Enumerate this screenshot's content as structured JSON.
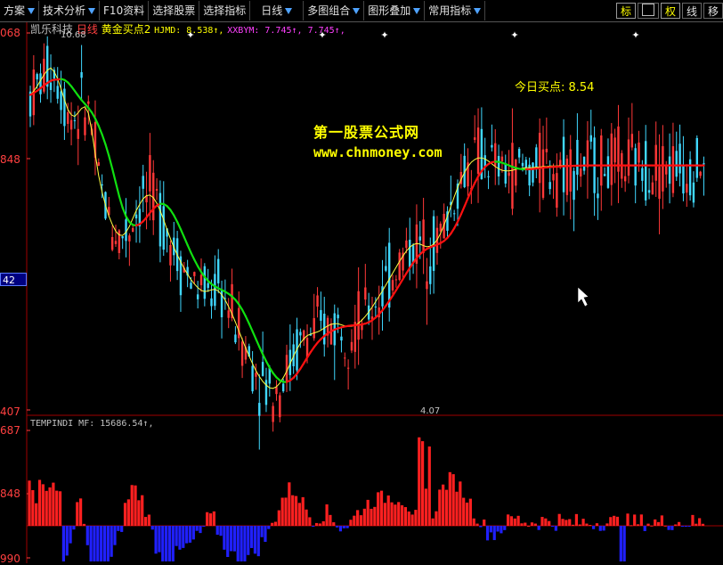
{
  "toolbar": {
    "items": [
      {
        "label": "方案",
        "dropdown": true
      },
      {
        "label": "技术分析",
        "dropdown": true
      },
      {
        "label": "F10资料",
        "dropdown": false
      },
      {
        "label": "选择股票",
        "dropdown": false
      },
      {
        "label": "选择指标",
        "dropdown": false
      },
      {
        "label": "日线",
        "dropdown": true
      },
      {
        "label": "多图组合",
        "dropdown": true
      },
      {
        "label": "图形叠加",
        "dropdown": true
      },
      {
        "label": "常用指标",
        "dropdown": true
      }
    ],
    "right_buttons": [
      "标",
      "",
      "权",
      "线",
      "移"
    ],
    "colors": {
      "dropdown_arrow": "#4fa3ff",
      "active": "#ffff00"
    }
  },
  "header": {
    "stock_name": "凯乐科技",
    "period": "日线",
    "indicator_name": "黄金买点2",
    "hjmd_label": "HJMD: 8.538↑,",
    "xxbym_label": "XXBYM: 7.745↑, 7.745↑,",
    "colors": {
      "stock": "#c0c0c0",
      "period": "#ff4040",
      "indicator": "#ffff00",
      "hjmd": "#ffff00",
      "xxbym": "#ff40ff"
    }
  },
  "watermark": {
    "line1": "第一股票公式网",
    "line2": "www.chnmoney.com"
  },
  "today_buy": "今日买点: 8.54",
  "price_axis": {
    "labels": [
      "068",
      "848",
      "42",
      "407"
    ],
    "current_tag": "42"
  },
  "high_marker": "10.68",
  "low_marker": "4.07",
  "sub_panel": {
    "title": "TEMPINDI MF: 15686.54↑,",
    "axis_labels": [
      "687",
      "848",
      "990"
    ]
  },
  "chart_data": [
    {
      "type": "line",
      "title": "",
      "ylim": [
        4.0,
        11.0
      ],
      "x": [
        0,
        4,
        8,
        12,
        16,
        20,
        24,
        28,
        32,
        36,
        40,
        44,
        48,
        52,
        56,
        60,
        64,
        68,
        72,
        76,
        80,
        84,
        88,
        92,
        96,
        100,
        104,
        108,
        112,
        116,
        120,
        124,
        128,
        132,
        136,
        140,
        144,
        148,
        152,
        156,
        160,
        164,
        168,
        172,
        176,
        180,
        184,
        188,
        192,
        196,
        200,
        204,
        208,
        212,
        216,
        220,
        224,
        228,
        232,
        236,
        240,
        244,
        248,
        252,
        256,
        260,
        264,
        268,
        272,
        276,
        280,
        284,
        288,
        292,
        296,
        300,
        304,
        308,
        312,
        316,
        320,
        324,
        328,
        332,
        336,
        340,
        344,
        348,
        352,
        356,
        360,
        364,
        368,
        372,
        376,
        380,
        384,
        388,
        392,
        396,
        400,
        404,
        408,
        412,
        416,
        420,
        424,
        428,
        432,
        436,
        440,
        444,
        448,
        452,
        456,
        460,
        464,
        468,
        472,
        476,
        480,
        484,
        488,
        492,
        496,
        500,
        504,
        508,
        512,
        516,
        520,
        524,
        528,
        532,
        536,
        540,
        544,
        548,
        552,
        556,
        560,
        564,
        568,
        572,
        576,
        580,
        584,
        588,
        592,
        596,
        600,
        604,
        608,
        612,
        616,
        620,
        624,
        628,
        632,
        636,
        640,
        644,
        648,
        652,
        656,
        660,
        664,
        668,
        672,
        676,
        680,
        684,
        688,
        692,
        696,
        700,
        704,
        708,
        712,
        716,
        720,
        724,
        728,
        732,
        736,
        740,
        744,
        748,
        752,
        756,
        760,
        764,
        768,
        772,
        776,
        780,
        784,
        788,
        792,
        796,
        800,
        804,
        808
      ],
      "series": [
        {
          "name": "HJMD",
          "color": "#ffff00",
          "values": [
            9.85,
            9.92,
            10.01,
            10.12,
            10.22,
            10.31,
            10.35,
            10.28,
            10.15,
            9.96,
            9.76,
            9.58,
            9.48,
            9.45,
            9.52,
            9.6,
            9.63,
            9.51,
            9.18,
            8.75,
            8.35,
            8.05,
            7.8,
            7.6,
            7.44,
            7.32,
            7.25,
            7.24,
            7.3,
            7.41,
            7.56,
            7.7,
            7.82,
            7.92,
            7.98,
            7.99,
            7.94,
            7.84,
            7.7,
            7.53,
            7.35,
            7.18,
            7.02,
            6.88,
            6.75,
            6.63,
            6.52,
            6.42,
            6.34,
            6.27,
            6.22,
            6.2,
            6.21,
            6.23,
            6.24,
            6.21,
            6.14,
            6.04,
            5.92,
            5.78,
            5.63,
            5.47,
            5.31,
            5.15,
            5.0,
            4.86,
            4.73,
            4.62,
            4.53,
            4.46,
            4.41,
            4.4,
            4.43,
            4.5,
            4.6,
            4.72,
            4.86,
            5.0,
            5.13,
            5.24,
            5.32,
            5.38,
            5.41,
            5.43,
            5.45,
            5.48,
            5.52,
            5.56,
            5.59,
            5.6,
            5.6,
            5.58,
            5.56,
            5.55,
            5.55,
            5.57,
            5.61,
            5.67,
            5.74,
            5.82,
            5.91,
            6.01,
            6.11,
            6.21,
            6.32,
            6.43,
            6.54,
            6.65,
            6.76,
            6.86,
            6.95,
            7.02,
            7.07,
            7.09,
            7.08,
            7.05,
            7.03,
            7.04,
            7.08,
            7.16,
            7.28,
            7.43,
            7.6,
            7.78,
            7.96,
            8.13,
            8.28,
            8.41,
            8.52,
            8.6,
            8.65,
            8.68,
            8.68,
            8.66,
            8.62,
            8.57,
            8.52,
            8.48,
            8.45,
            8.44,
            8.44,
            8.45,
            8.47,
            8.48,
            8.49,
            8.5,
            8.5,
            8.5,
            8.51,
            8.51,
            8.52,
            8.52,
            8.53,
            8.53,
            8.53,
            8.54,
            8.54,
            8.54,
            8.54,
            8.54,
            8.54,
            8.54,
            8.54,
            8.54,
            8.54,
            8.54,
            8.54,
            8.54,
            8.54,
            8.54,
            8.54,
            8.54,
            8.54,
            8.54,
            8.54,
            8.54,
            8.54,
            8.54,
            8.54,
            8.54,
            8.54,
            8.54,
            8.54,
            8.54,
            8.54,
            8.54,
            8.54,
            8.54,
            8.54,
            8.54,
            8.54,
            8.54,
            8.54,
            8.54,
            8.54,
            8.54,
            8.54,
            8.54
          ]
        }
      ]
    },
    {
      "type": "bar",
      "title": "",
      "series": [
        {
          "name": "MF",
          "positive_color": "#ff2020",
          "negative_color": "#2020ff"
        }
      ]
    }
  ]
}
